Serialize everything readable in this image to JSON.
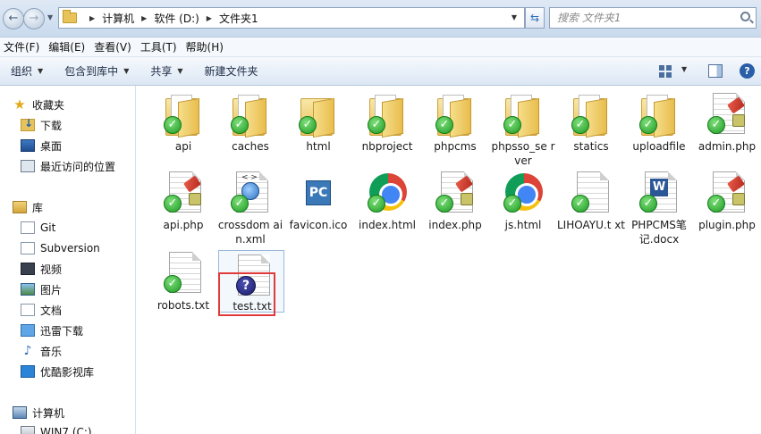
{
  "address": {
    "back_glyph": "←",
    "forward_glyph": "→",
    "crumbs": [
      "计算机",
      "软件 (D:)",
      "文件夹1"
    ],
    "search_placeholder": "搜索 文件夹1"
  },
  "menubar": [
    "文件(F)",
    "编辑(E)",
    "查看(V)",
    "工具(T)",
    "帮助(H)"
  ],
  "toolbar": {
    "organize": "组织",
    "include_library": "包含到库中",
    "share": "共享",
    "new_folder": "新建文件夹",
    "help": "?"
  },
  "sidebar": {
    "favorites": "收藏夹",
    "downloads": "下载",
    "desktop": "桌面",
    "recent": "最近访问的位置",
    "libraries": "库",
    "git": "Git",
    "subversion": "Subversion",
    "videos": "视频",
    "pictures": "图片",
    "documents": "文档",
    "thunder": "迅雷下载",
    "music": "音乐",
    "youku": "优酷影视库",
    "computer": "计算机",
    "drive_c": "WIN7 (C:)"
  },
  "files": {
    "api": "api",
    "caches": "caches",
    "html": "html",
    "nbproject": "nbproject",
    "phpcms": "phpcms",
    "phpsso_server": "phpsso_se rver",
    "statics": "statics",
    "uploadfile": "uploadfile",
    "admin_php": "admin.php",
    "api_php": "api.php",
    "crossdomain": "crossdom ain.xml",
    "favicon": "favicon.ico",
    "index_html": "index.html",
    "index_php": "index.php",
    "js_html": "js.html",
    "lihoayu": "LIHOAYU.t xt",
    "phpcms_doc": "PHPCMS笔 记.docx",
    "plugin_php": "plugin.php",
    "robots": "robots.txt",
    "test": "test.txt"
  },
  "glyphs": {
    "check": "✓",
    "question": "?",
    "fav": "PC",
    "word": "W",
    "xml": "<  >",
    "music": "♪",
    "star": "★"
  }
}
